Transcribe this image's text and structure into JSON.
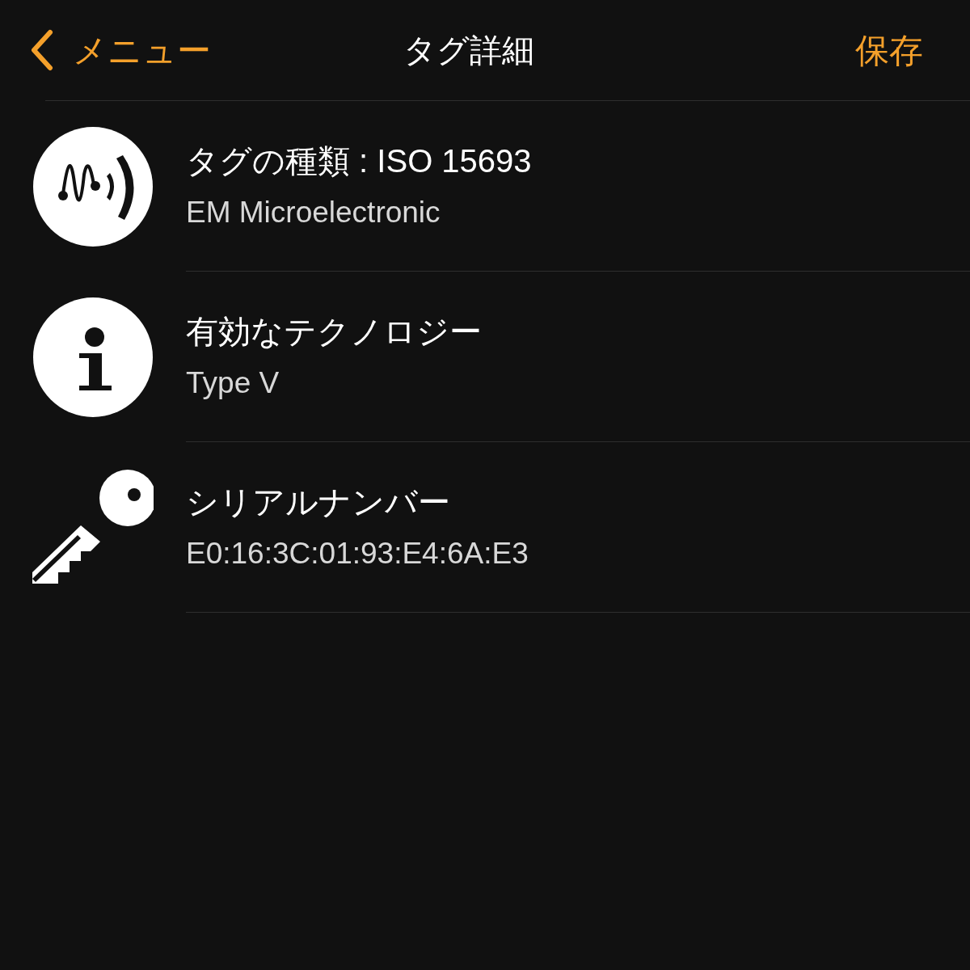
{
  "nav_bar": {
    "back_label": "メニュー",
    "title": "タグ詳細",
    "save_label": "保存"
  },
  "rows": [
    {
      "kind": "tag",
      "title": "タグの種類 : ISO 15693",
      "detail": "EM Microelectronic"
    },
    {
      "kind": "info",
      "title": "有効なテクノロジー",
      "detail": "Type V"
    },
    {
      "kind": "key",
      "title": "シリアルナンバー",
      "detail": "E0:16:3C:01:93:E4:6A:E3"
    }
  ]
}
